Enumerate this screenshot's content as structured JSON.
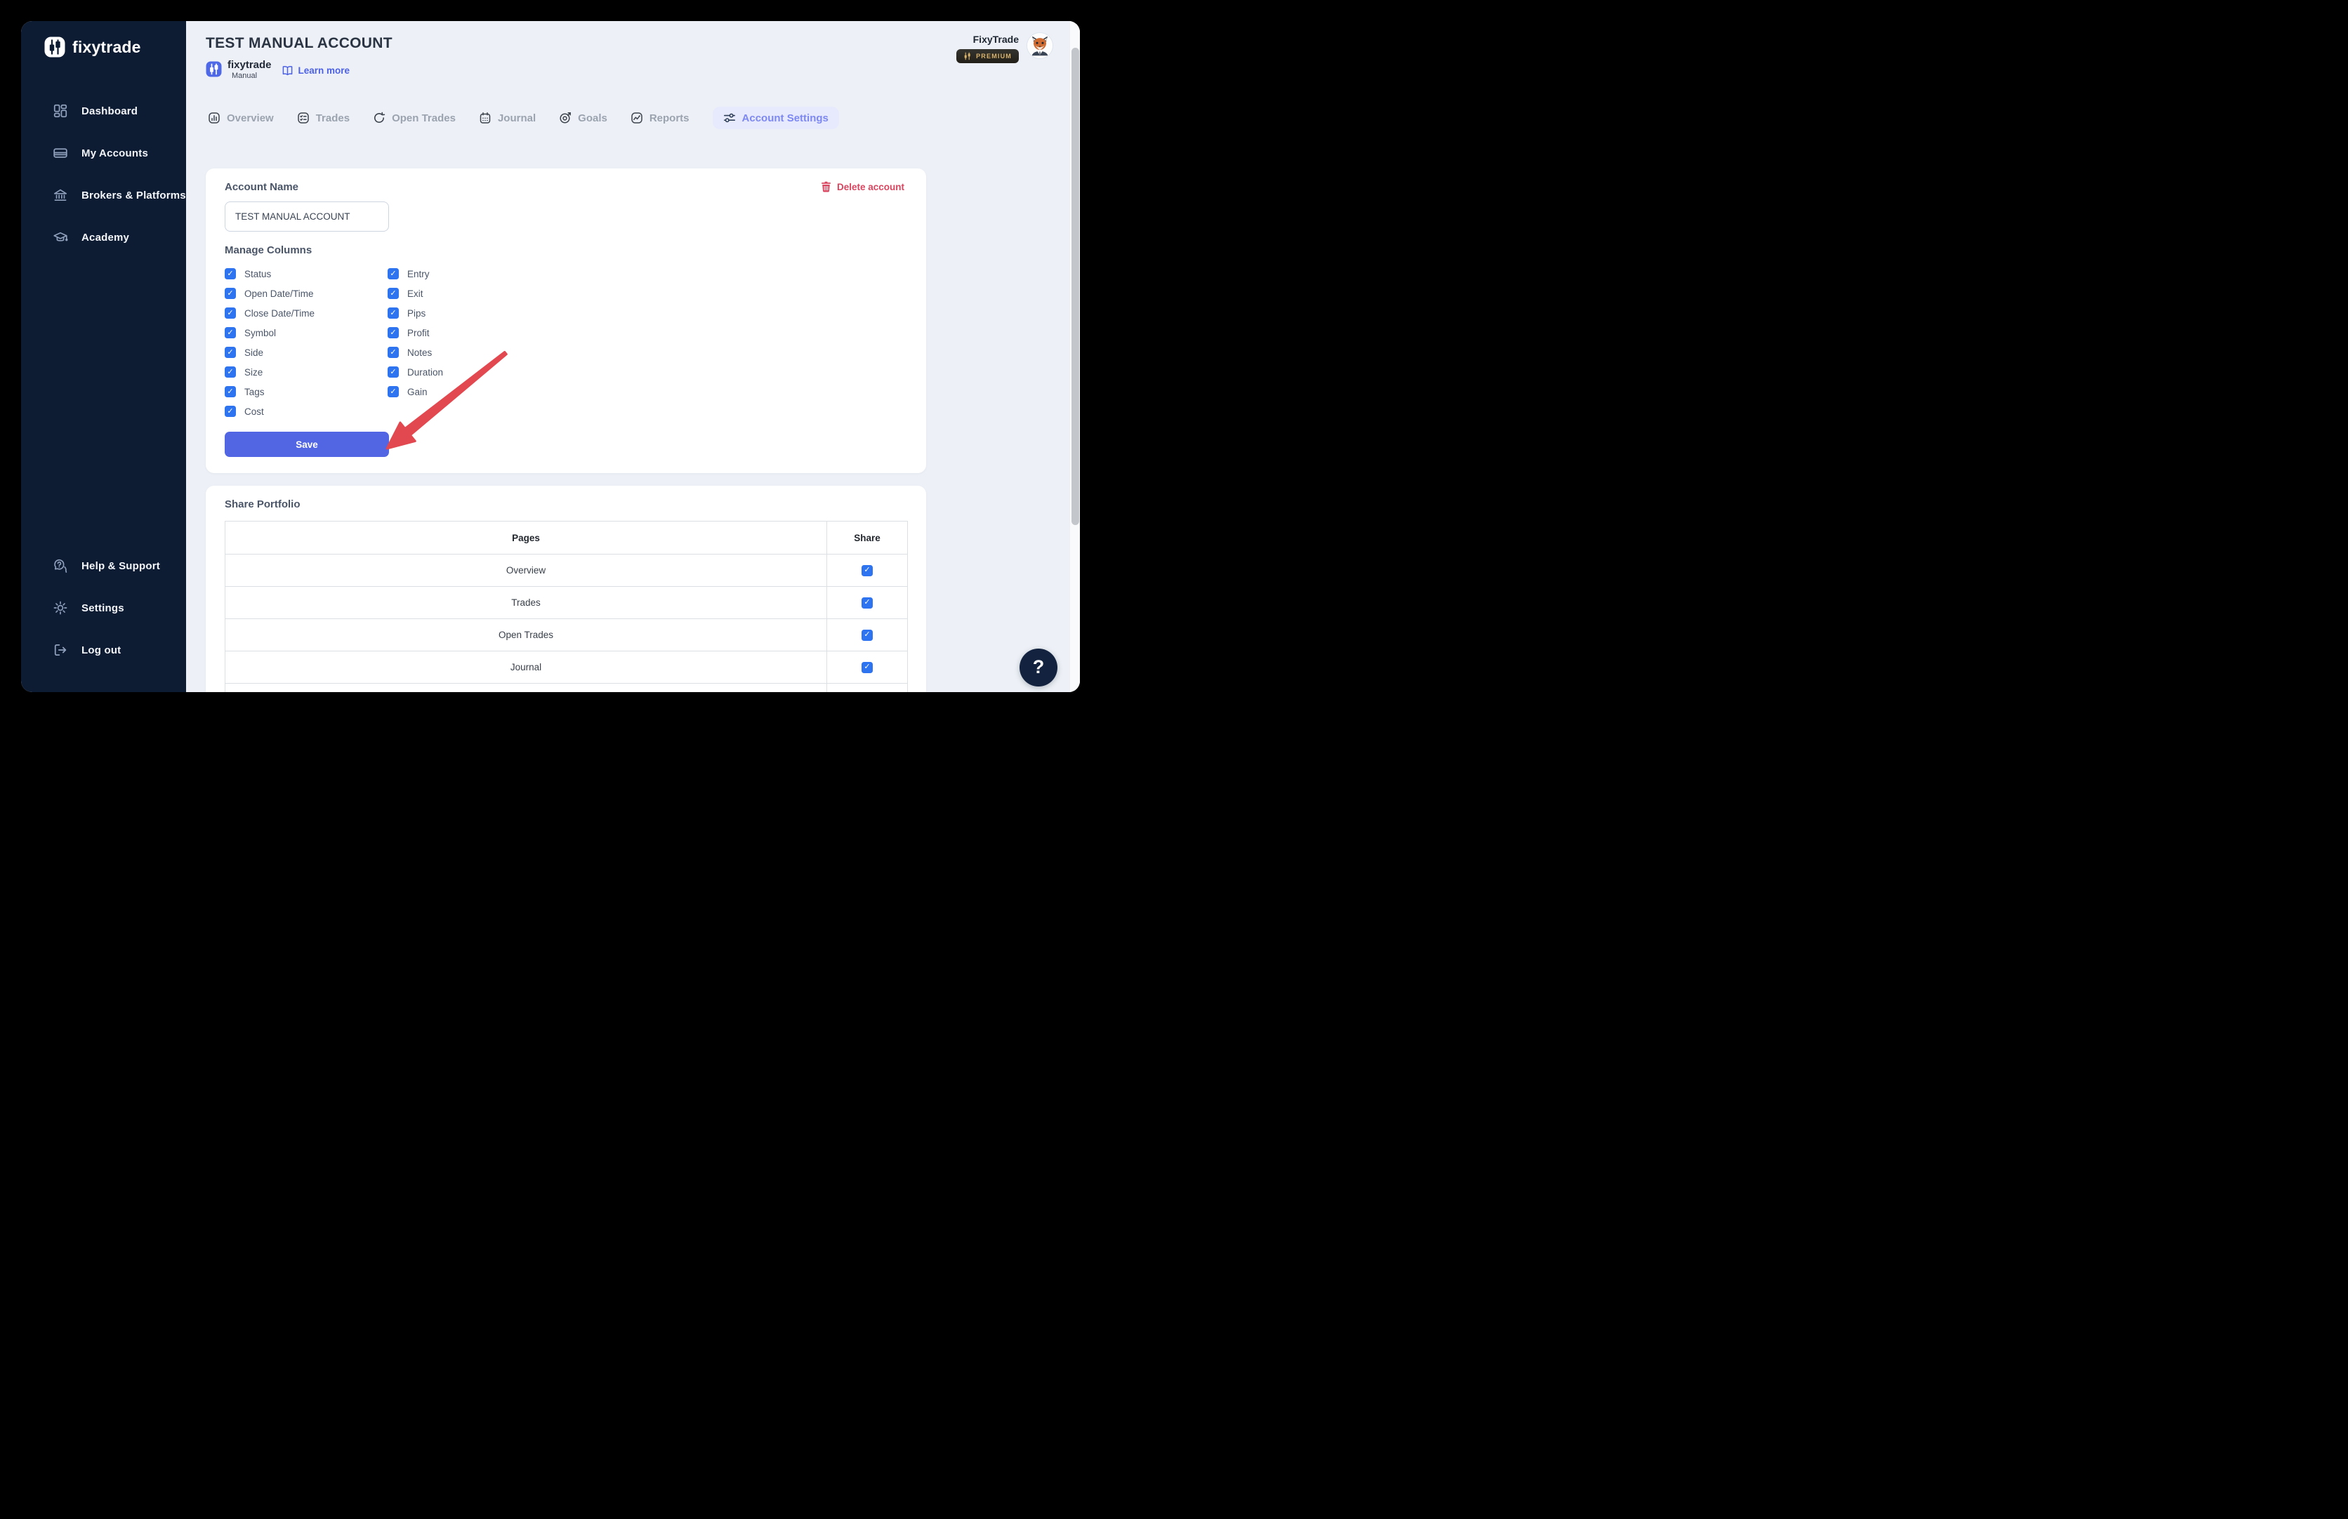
{
  "colors": {
    "sidebar_bg": "#0e1c33",
    "main_bg": "#edf1f7",
    "checkbox_blue": "#2e74f0",
    "save_button_blue": "#5266e4",
    "active_tab_text": "#7d88f2",
    "active_tab_bg": "#e7eafc",
    "link_blue": "#4c61e4",
    "delete_red": "#d9455f",
    "annotation_arrow_red": "#e2484f",
    "premium_gold": "#d9b36b"
  },
  "sidebar": {
    "logo_label": "fixytrade",
    "items": [
      {
        "label": "Dashboard",
        "icon": "dashboard-icon"
      },
      {
        "label": "My Accounts",
        "icon": "accounts-card-icon"
      },
      {
        "label": "Brokers & Platforms",
        "icon": "bank-icon"
      },
      {
        "label": "Academy",
        "icon": "academy-cap-icon"
      }
    ],
    "footer_items": [
      {
        "label": "Help & Support",
        "icon": "help-chat-icon"
      },
      {
        "label": "Settings",
        "icon": "gear-icon"
      },
      {
        "label": "Log out",
        "icon": "logout-icon"
      }
    ]
  },
  "header": {
    "title": "TEST MANUAL ACCOUNT",
    "account_badge": {
      "brand": "fixytrade",
      "type": "Manual",
      "icon": "manual-candlestick-icon"
    },
    "learn_more_label": "Learn more"
  },
  "user": {
    "name": "FixyTrade",
    "plan_badge": "PREMIUM",
    "avatar": "fox-avatar"
  },
  "tabs": [
    {
      "label": "Overview",
      "icon": "overview-chart-icon",
      "active": false
    },
    {
      "label": "Trades",
      "icon": "trades-list-icon",
      "active": false
    },
    {
      "label": "Open Trades",
      "icon": "refresh-icon",
      "active": false
    },
    {
      "label": "Journal",
      "icon": "calendar-icon",
      "active": false
    },
    {
      "label": "Goals",
      "icon": "target-icon",
      "active": false
    },
    {
      "label": "Reports",
      "icon": "report-chart-icon",
      "active": false
    },
    {
      "label": "Account Settings",
      "icon": "sliders-icon",
      "active": true
    }
  ],
  "account_settings": {
    "account_name_label": "Account Name",
    "account_name_value": "TEST MANUAL ACCOUNT",
    "delete_account_label": "Delete account",
    "manage_columns_label": "Manage Columns",
    "columns_left": [
      {
        "label": "Status",
        "checked": true
      },
      {
        "label": "Open Date/Time",
        "checked": true
      },
      {
        "label": "Close Date/Time",
        "checked": true
      },
      {
        "label": "Symbol",
        "checked": true
      },
      {
        "label": "Side",
        "checked": true
      },
      {
        "label": "Size",
        "checked": true
      },
      {
        "label": "Tags",
        "checked": true
      },
      {
        "label": "Cost",
        "checked": true
      }
    ],
    "columns_right": [
      {
        "label": "Entry",
        "checked": true
      },
      {
        "label": "Exit",
        "checked": true
      },
      {
        "label": "Pips",
        "checked": true
      },
      {
        "label": "Profit",
        "checked": true
      },
      {
        "label": "Notes",
        "checked": true
      },
      {
        "label": "Duration",
        "checked": true
      },
      {
        "label": "Gain",
        "checked": true
      }
    ],
    "save_label": "Save"
  },
  "share_portfolio": {
    "title": "Share Portfolio",
    "headers": {
      "pages": "Pages",
      "share": "Share"
    },
    "rows": [
      {
        "page": "Overview",
        "shared": true
      },
      {
        "page": "Trades",
        "shared": true
      },
      {
        "page": "Open Trades",
        "shared": true
      },
      {
        "page": "Journal",
        "shared": true
      }
    ]
  },
  "floating_help_label": "?"
}
